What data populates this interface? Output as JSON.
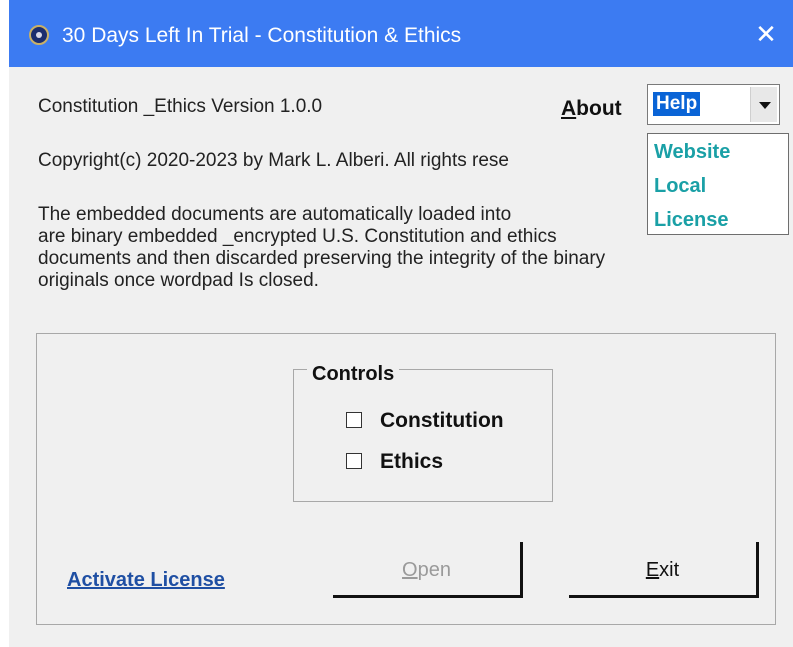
{
  "window": {
    "title": "30 Days Left In Trial - Constitution & Ethics",
    "close_glyph": "✕",
    "title_bar_color": "#3c7bf2"
  },
  "info": {
    "version": "Constitution _Ethics Version 1.0.0",
    "copyright": "Copyright(c) 2020-2023 by Mark L. Alberi. All rights rese",
    "description_lines": [
      "The embedded documents are automatically loaded into",
      "are binary embedded _encrypted U.S. Constitution and ethics",
      "documents and then discarded preserving the integrity of the binary",
      "originals once wordpad Is closed."
    ]
  },
  "about": {
    "label_first": "A",
    "label_rest": "bout",
    "selected": "Help",
    "options": [
      "Website",
      "Local",
      "License"
    ]
  },
  "controls": {
    "title": "Controls",
    "checkboxes": [
      {
        "label": "Constitution",
        "checked": false
      },
      {
        "label": "Ethics",
        "checked": false
      }
    ]
  },
  "actions": {
    "activate_link": "Activate License",
    "open_first": "O",
    "open_rest": "pen",
    "exit_first": "E",
    "exit_rest": "xit",
    "open_enabled": false
  },
  "icons": {
    "app": "seal-icon",
    "close": "close-icon",
    "dropdown": "chevron-down-icon"
  }
}
